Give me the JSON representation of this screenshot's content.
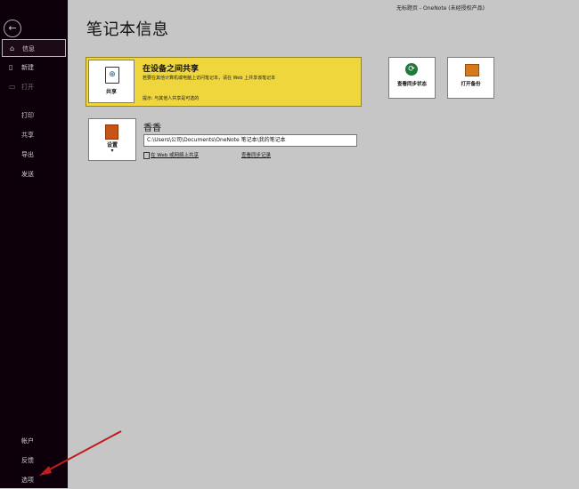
{
  "window": {
    "title": "无标题页  -  OneNote (未经授权产品)"
  },
  "sidebar": {
    "items": [
      {
        "label": "信息"
      },
      {
        "label": "新建"
      },
      {
        "label": "打开"
      },
      {
        "label": "打印"
      },
      {
        "label": "共享"
      },
      {
        "label": "导出"
      },
      {
        "label": "发送"
      },
      {
        "label": "帐户"
      },
      {
        "label": "反馈"
      },
      {
        "label": "选项"
      }
    ]
  },
  "main": {
    "title": "笔记本信息",
    "share": {
      "button_label": "共享",
      "title": "在设备之间共享",
      "description": "若要在其他计算机或电脑上访问笔记本，请在 Web 上共享该笔记本",
      "hint": "提示: 与其他人共享是可选的"
    },
    "tiles": [
      {
        "label": "查看同步状态"
      },
      {
        "label": "打开备份"
      }
    ],
    "notebook": {
      "settings_label": "设置",
      "name": "香香",
      "path": "C:\\Users\\公司\\Documents\\OneNote 笔记本\\我的笔记本",
      "open_web_link": "在 Web 或网络上共享",
      "view_sync_link": "查看同步记录"
    }
  },
  "colors": {
    "accent": "#efd63c",
    "sidebar": "#0d000a",
    "arrow": "#c21c1c"
  }
}
